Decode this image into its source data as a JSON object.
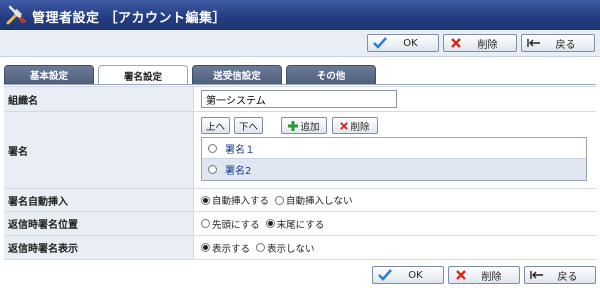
{
  "window": {
    "title": "管理者設定 ［アカウント編集］"
  },
  "toolbar": {
    "ok_label": "OK",
    "delete_label": "削除",
    "back_label": "戻る"
  },
  "tabs": [
    {
      "label": "基本設定",
      "active": false
    },
    {
      "label": "署名設定",
      "active": true
    },
    {
      "label": "送受信設定",
      "active": false
    },
    {
      "label": "その他",
      "active": false
    }
  ],
  "form": {
    "org_name": {
      "label": "組織名",
      "value": "第一システム"
    },
    "signature": {
      "label": "署名",
      "up_label": "上へ",
      "down_label": "下へ",
      "add_label": "追加",
      "delete_label": "削除",
      "items": [
        "署名１",
        "署名2"
      ]
    },
    "auto_insert": {
      "label": "署名自動挿入",
      "options": [
        "自動挿入する",
        "自動挿入しない"
      ],
      "selected": 0
    },
    "reply_position": {
      "label": "返信時署名位置",
      "options": [
        "先頭にする",
        "末尾にする"
      ],
      "selected": 1
    },
    "reply_display": {
      "label": "返信時署名表示",
      "options": [
        "表示する",
        "表示しない"
      ],
      "selected": 0
    }
  },
  "colors": {
    "titlebar": "#243c80",
    "label_bg": "#e9eef5",
    "tab_inactive": "#5a6b88",
    "ok_check": "#2a7fd4",
    "delete_x": "#d9261c"
  }
}
